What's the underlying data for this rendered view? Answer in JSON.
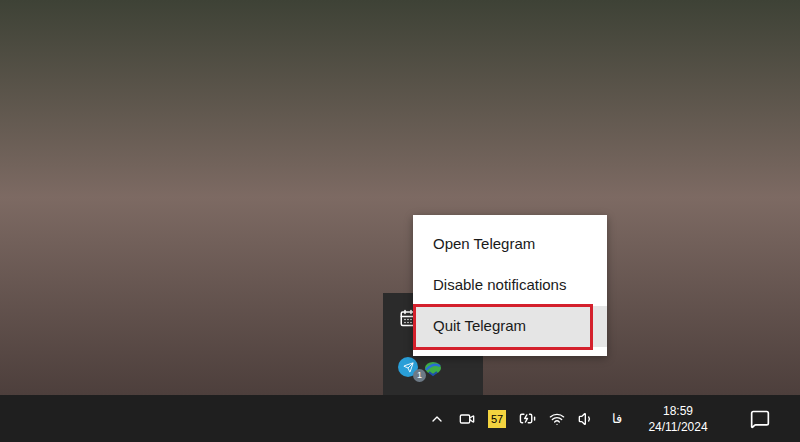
{
  "context_menu": {
    "items": [
      {
        "label": "Open Telegram",
        "selected": false,
        "annotated": false
      },
      {
        "label": "Disable notifications",
        "selected": false,
        "annotated": false
      },
      {
        "label": "Quit Telegram",
        "selected": true,
        "annotated": true
      }
    ],
    "annotation_color": "#d4202c"
  },
  "tray_overflow": {
    "icons": [
      {
        "kind": "calendar",
        "badge": ""
      },
      {
        "kind": "telegram",
        "badge": "1"
      },
      {
        "kind": "download-manager",
        "badge": ""
      }
    ]
  },
  "taskbar": {
    "tray_badge": "57",
    "language": "فا",
    "clock": {
      "time": "18:59",
      "date": "24/11/2024"
    }
  }
}
